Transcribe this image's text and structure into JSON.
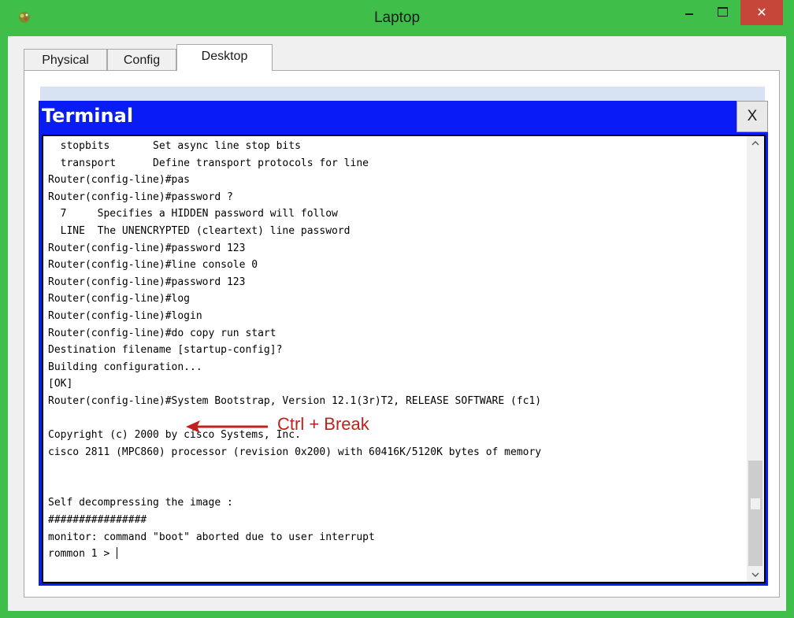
{
  "window": {
    "title": "Laptop",
    "close_glyph": "✕",
    "accent_color": "#3fbf4a",
    "close_color": "#c7463a"
  },
  "tabs": [
    {
      "label": "Physical",
      "active": false
    },
    {
      "label": "Config",
      "active": false
    },
    {
      "label": "Desktop",
      "active": true
    }
  ],
  "terminal": {
    "title": "Terminal",
    "close_label": "X",
    "title_bar_color": "#0a1cf5",
    "lines": [
      "  stopbits       Set async line stop bits",
      "  transport      Define transport protocols for line",
      "Router(config-line)#pas",
      "Router(config-line)#password ?",
      "  7     Specifies a HIDDEN password will follow",
      "  LINE  The UNENCRYPTED (cleartext) line password",
      "Router(config-line)#password 123",
      "Router(config-line)#line console 0",
      "Router(config-line)#password 123",
      "Router(config-line)#log",
      "Router(config-line)#login",
      "Router(config-line)#do copy run start",
      "Destination filename [startup-config]?",
      "Building configuration...",
      "[OK]",
      "Router(config-line)#System Bootstrap, Version 12.1(3r)T2, RELEASE SOFTWARE (fc1)",
      "",
      "Copyright (c) 2000 by cisco Systems, Inc.",
      "cisco 2811 (MPC860) processor (revision 0x200) with 60416K/5120K bytes of memory",
      "",
      "",
      "Self decompressing the image :",
      "################",
      "monitor: command \"boot\" aborted due to user interrupt",
      "rommon 1 > "
    ]
  },
  "annotation": {
    "label": "Ctrl + Break",
    "color": "#c0211c"
  },
  "icons": {
    "app": "packet-tracer-icon",
    "minimize": "minimize-icon",
    "maximize": "maximize-icon",
    "close": "close-icon",
    "scroll_up": "chevron-up-icon",
    "scroll_down": "chevron-down-icon",
    "arrow": "arrow-left-icon"
  }
}
